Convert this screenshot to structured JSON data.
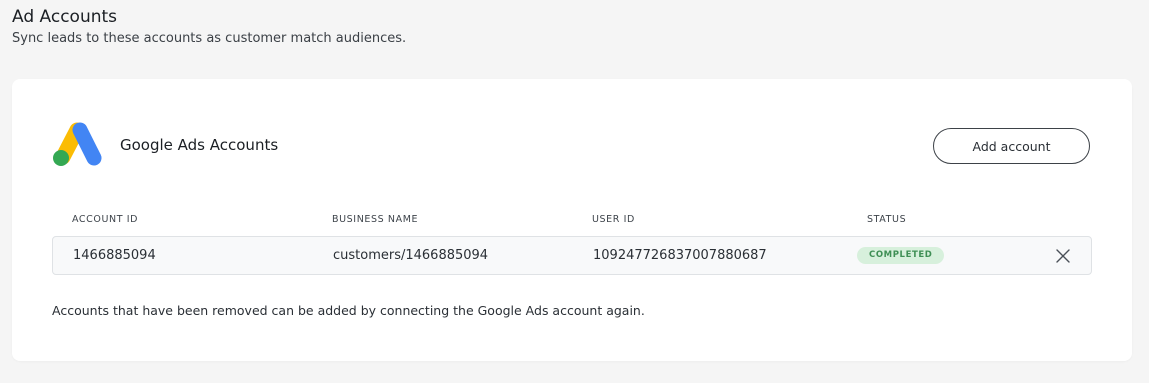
{
  "page": {
    "title": "Ad Accounts",
    "subtitle": "Sync leads to these accounts as customer match audiences."
  },
  "card": {
    "logo_icon": "google-ads-logo",
    "title": "Google Ads Accounts",
    "add_button_label": "Add account",
    "columns": {
      "account_id": "ACCOUNT ID",
      "business_name": "BUSINESS NAME",
      "user_id": "USER ID",
      "status": "STATUS"
    },
    "rows": [
      {
        "account_id": "1466885094",
        "business_name": "customers/1466885094",
        "user_id": "109247726837007880687",
        "status": "COMPLETED",
        "remove_icon": "close-icon"
      }
    ],
    "footnote": "Accounts that have been removed can be added by connecting the Google Ads account again."
  },
  "colors": {
    "background": "#f5f5f5",
    "card": "#ffffff",
    "status_badge_bg": "#d7f0dc",
    "status_badge_text": "#3f8f55",
    "google_blue": "#4285f4",
    "google_yellow": "#fbbc04",
    "google_green": "#34a853"
  }
}
